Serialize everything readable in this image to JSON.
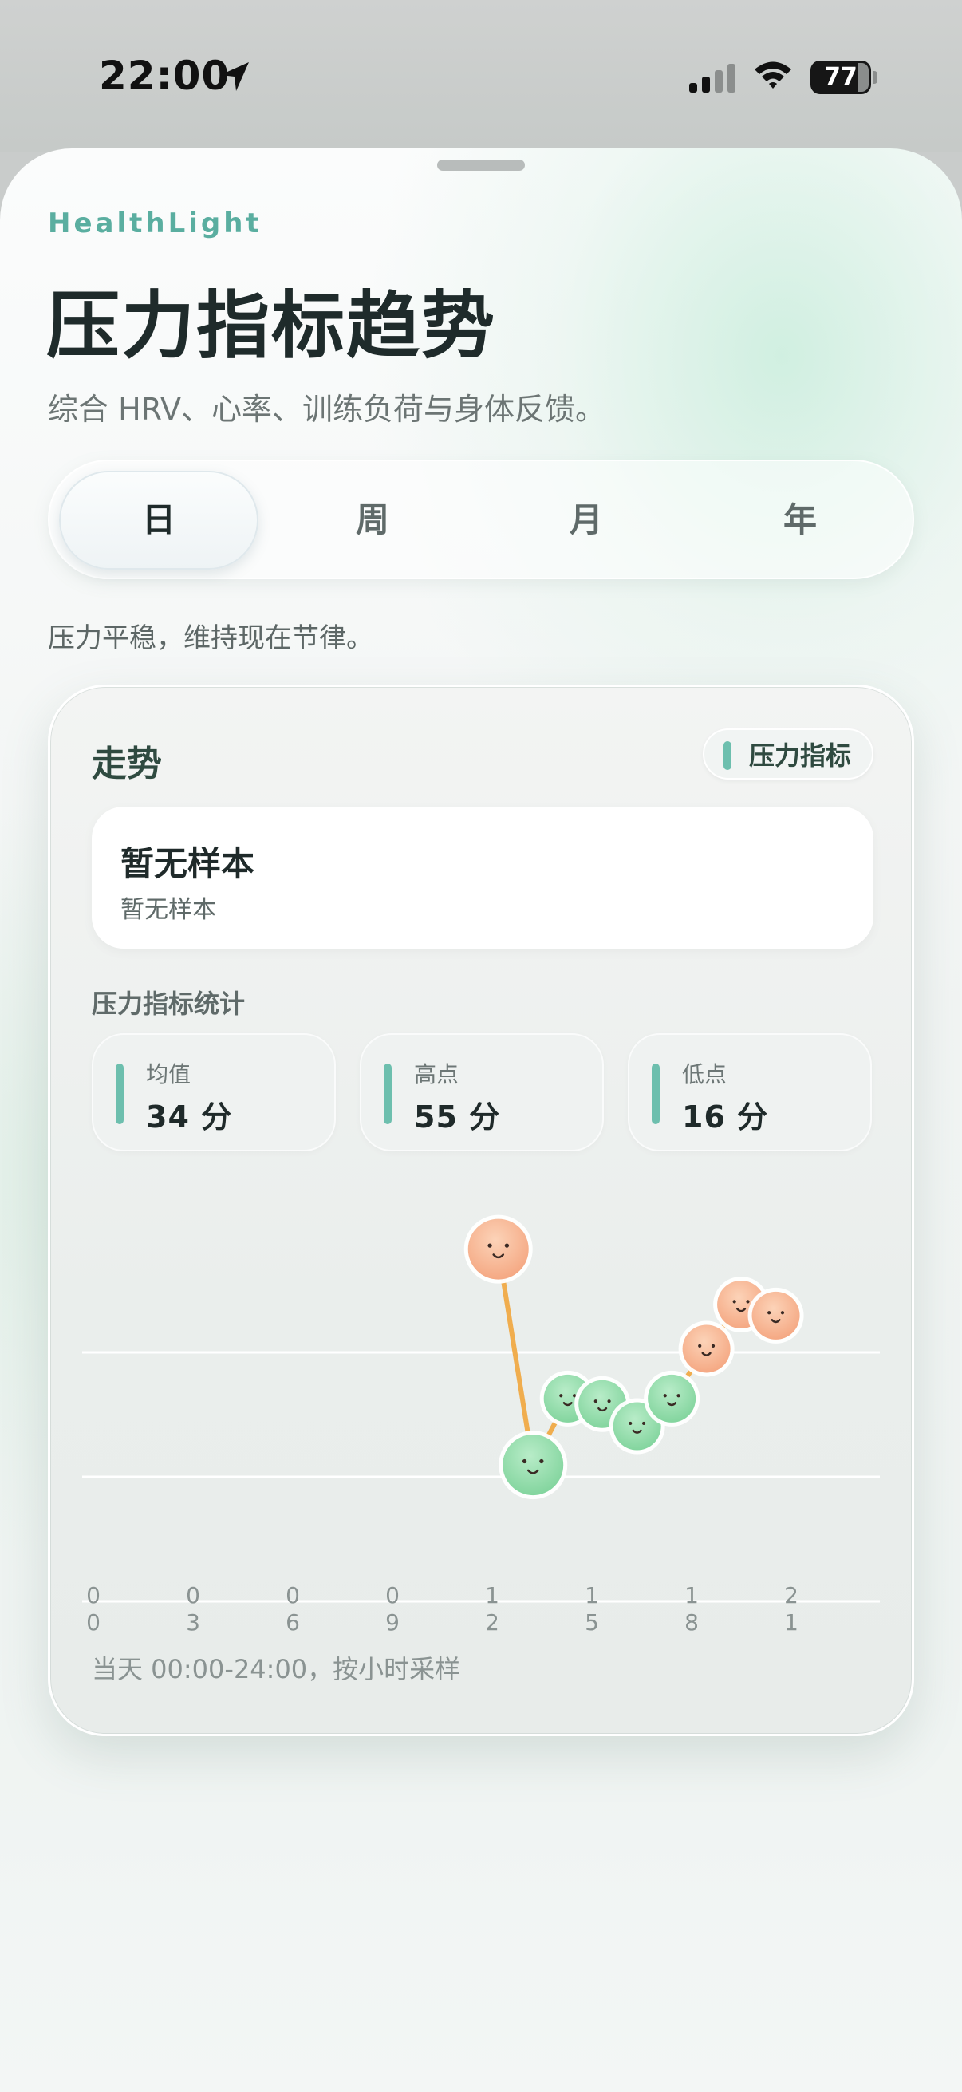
{
  "status_bar": {
    "time": "22:00",
    "battery": "77"
  },
  "app": {
    "brand": "HealthLight",
    "title": "压力指标趋势",
    "subtitle": "综合 HRV、心率、训练负荷与身体反馈。"
  },
  "segments": [
    {
      "label": "日",
      "active": true
    },
    {
      "label": "周",
      "active": false
    },
    {
      "label": "月",
      "active": false
    },
    {
      "label": "年",
      "active": false
    }
  ],
  "status_message": "压力平稳，维持现在节律。",
  "card": {
    "title": "走势",
    "legend_label": "压力指标",
    "empty_title": "暂无样本",
    "empty_subtitle": "暂无样本",
    "stats_heading": "压力指标统计",
    "stats": [
      {
        "label": "均值",
        "value": "34 分"
      },
      {
        "label": "高点",
        "value": "55 分"
      },
      {
        "label": "低点",
        "value": "16 分"
      }
    ],
    "caption": "当天 00:00-24:00，按小时采样"
  },
  "colors": {
    "accent": "#6dbfae",
    "brand": "#5aaea0",
    "line": "#f0ad4e",
    "high_face": "#f4a57f",
    "low_face": "#7fd39b"
  },
  "chart_data": {
    "type": "line",
    "x_tick_labels": [
      "00",
      "03",
      "06",
      "09",
      "12",
      "15",
      "18",
      "21"
    ],
    "xlim": [
      0,
      23
    ],
    "ylim": [
      0,
      60
    ],
    "grid": true,
    "series": [
      {
        "x": [
          12,
          13,
          14,
          15,
          16,
          17,
          18,
          19,
          20
        ],
        "y": [
          55,
          16,
          28,
          27,
          23,
          28,
          37,
          45,
          43
        ],
        "marker_mood": [
          "high",
          "low",
          "low",
          "low",
          "low",
          "low",
          "high",
          "high",
          "high"
        ]
      }
    ]
  }
}
